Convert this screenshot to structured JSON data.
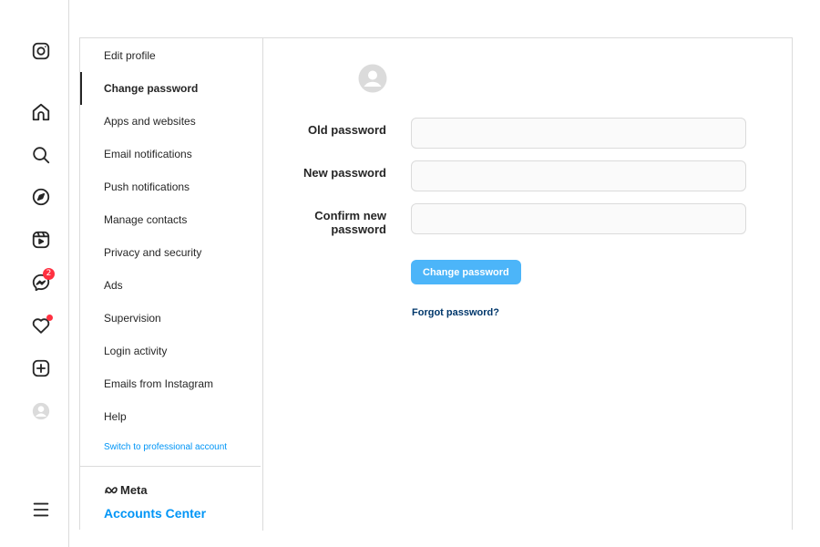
{
  "nav": {
    "icons": [
      "instagram-icon",
      "home-icon",
      "search-icon",
      "explore-icon",
      "reels-icon",
      "messenger-icon",
      "heart-icon",
      "create-icon",
      "profile-avatar-icon",
      "more-menu-icon"
    ],
    "messages_badge": "2"
  },
  "settings_menu": {
    "items": [
      {
        "label": "Edit profile"
      },
      {
        "label": "Change password"
      },
      {
        "label": "Apps and websites"
      },
      {
        "label": "Email notifications"
      },
      {
        "label": "Push notifications"
      },
      {
        "label": "Manage contacts"
      },
      {
        "label": "Privacy and security"
      },
      {
        "label": "Ads"
      },
      {
        "label": "Supervision"
      },
      {
        "label": "Login activity"
      },
      {
        "label": "Emails from Instagram"
      },
      {
        "label": "Help"
      }
    ],
    "active_item": "Change password",
    "switch_account": "Switch to professional account",
    "meta_label": "Meta",
    "accounts_center": "Accounts Center"
  },
  "form": {
    "old_password_label": "Old password",
    "new_password_label": "New password",
    "confirm_label_line1": "Confirm new",
    "confirm_label_line2": "password",
    "old_password_value": "",
    "new_password_value": "",
    "confirm_password_value": "",
    "submit_label": "Change password",
    "forgot_label": "Forgot password?"
  },
  "colors": {
    "link_blue": "#0095f6",
    "button_blue": "#4cb5f9",
    "dark_link": "#00376b",
    "notification_red": "#ff3040",
    "border": "#dbdbdb"
  }
}
